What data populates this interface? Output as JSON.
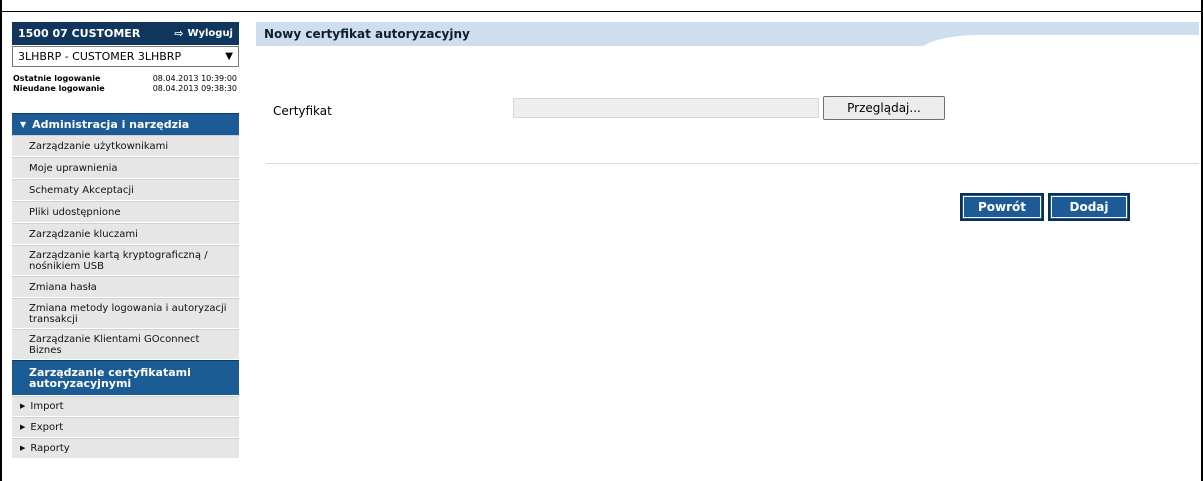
{
  "sidebar": {
    "customer_name": "1500 07 CUSTOMER",
    "logout_label": "Wyloguj",
    "customer_select_value": "3LHBRP - CUSTOMER 3LHBRP",
    "last_login_label": "Ostatnie logowanie",
    "last_login_value": "08.04.2013 10:39:00",
    "failed_login_label": "Nieudane logowanie",
    "failed_login_value": "08.04.2013 09:38:30",
    "section_title": "Administracja i narzędzia",
    "items": [
      {
        "label": "Zarządzanie użytkownikami"
      },
      {
        "label": "Moje uprawnienia"
      },
      {
        "label": "Schematy Akceptacji"
      },
      {
        "label": "Pliki udostępnione"
      },
      {
        "label": "Zarządzanie kluczami"
      },
      {
        "label": "Zarządzanie kartą kryptograficzną / nośnikiem USB"
      },
      {
        "label": "Zmiana hasła"
      },
      {
        "label": "Zmiana metody logowania i autoryzacji transakcji"
      },
      {
        "label": "Zarządzanie Klientami GOconnect Biznes"
      },
      {
        "label": "Zarządzanie certyfikatami autoryzacyjnymi"
      }
    ],
    "sub_sections": [
      {
        "label": "Import"
      },
      {
        "label": "Export"
      },
      {
        "label": "Raporty"
      }
    ]
  },
  "main": {
    "title": "Nowy certyfikat autoryzacyjny",
    "field_label": "Certyfikat",
    "browse_label": "Przeglądaj...",
    "back_label": "Powrót",
    "add_label": "Dodaj"
  },
  "colors": {
    "accent": "#1c5b95",
    "dark": "#10365e",
    "title_bg": "#cfdeee"
  }
}
